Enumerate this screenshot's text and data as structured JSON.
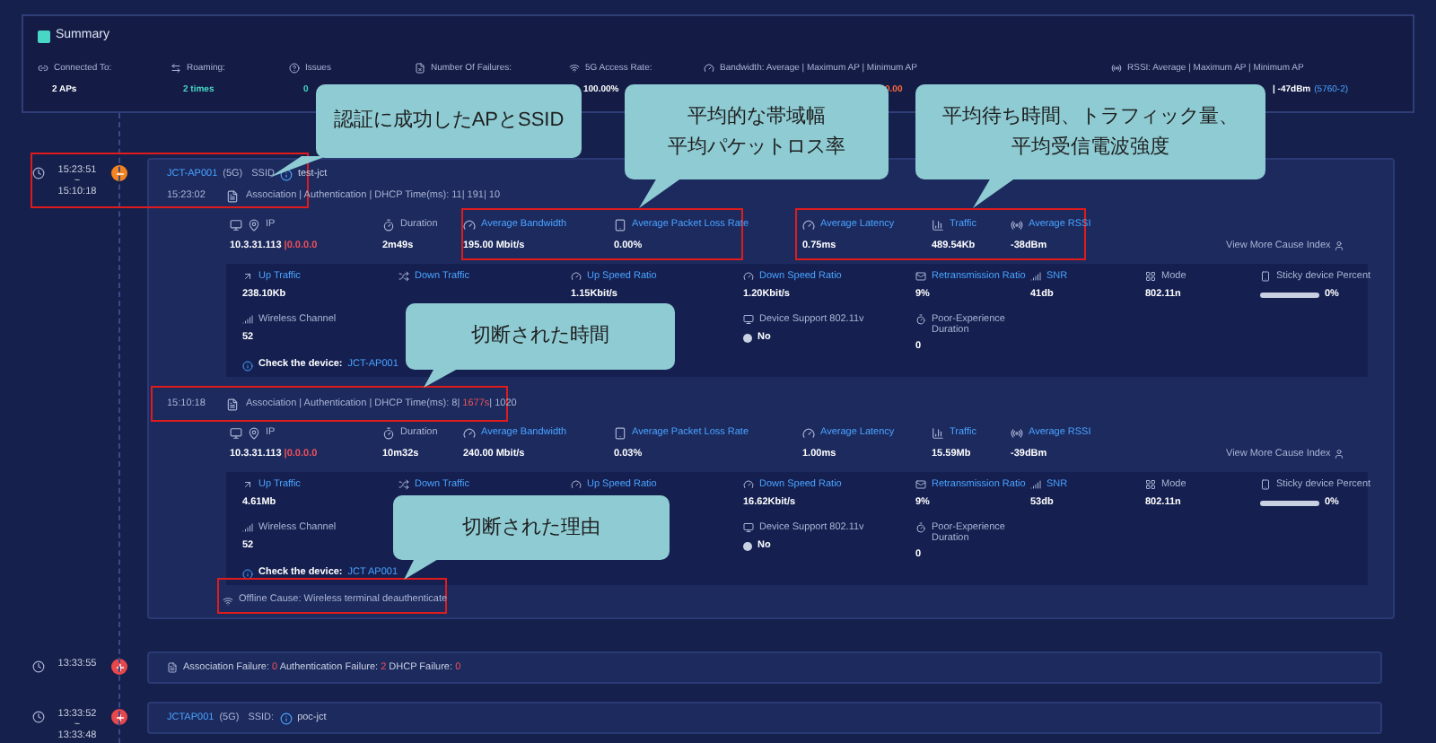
{
  "summary": {
    "title": "Summary",
    "items": [
      {
        "kind": "link",
        "label": "Connected To:",
        "value": "2 APs"
      },
      {
        "kind": "roam",
        "label": "Roaming:",
        "value": "2 times"
      },
      {
        "kind": "help",
        "label": "Issues",
        "value": "0"
      },
      {
        "kind": "fail",
        "label": "Number Of Failures:"
      },
      {
        "kind": "wifi",
        "label": "5G Access Rate:",
        "value": "100.00%"
      },
      {
        "kind": "gauge",
        "label": "Bandwidth: Average | Maximum AP | Minimum AP",
        "value_alert": "0.00"
      },
      {
        "kind": "signal",
        "label": "RSSI: Average | Maximum AP | Minimum AP",
        "value": "| -47dBm",
        "value_link": "(5760-2)"
      }
    ]
  },
  "timeline": [
    {
      "kind": "session",
      "expanded": true,
      "color": "#f5841f",
      "time_start": "15:23:51",
      "time_separator": "~",
      "time_end": "15:10:18",
      "ap": "JCT-AP001",
      "band": "(5G)",
      "ssid_label": "SSID",
      "ssid": "test-jct",
      "connections": [
        {
          "time": "15:23:02",
          "parts": [
            {
              "text": "Association | Authentication | DHCP Time(ms): 11| 191| 10",
              "alert": false
            }
          ],
          "metrics": [
            {
              "kind": "ip",
              "label": "IP",
              "value": "10.3.31.113",
              "value_alert": "|0.0.0.0",
              "link": false
            },
            {
              "kind": "time",
              "label": "Duration",
              "value": "2m49s",
              "link": false
            },
            {
              "kind": "gauge",
              "label": "Average Bandwidth",
              "value": "195.00 Mbit/s",
              "link": true
            },
            {
              "kind": "loss",
              "label": "Average Packet Loss Rate",
              "value": "0.00%",
              "link": true
            },
            {
              "kind": "gauge",
              "label": "Average Latency",
              "value": "0.75ms",
              "link": true
            },
            {
              "kind": "chart",
              "label": "Traffic",
              "value": "489.54Kb",
              "link": true
            },
            {
              "kind": "signal",
              "label": "Average RSSI",
              "value": "-38dBm",
              "link": true
            }
          ],
          "more": "View More Cause Index",
          "detail_rows": [
            [
              {
                "kind": "up",
                "label": "Up Traffic",
                "value": "238.10Kb",
                "link": true
              },
              {
                "kind": "cross",
                "label": "Down Traffic",
                "link": true
              },
              {
                "kind": "speed",
                "label": "Up Speed Ratio",
                "value": "1.15Kbit/s",
                "link": true
              },
              {
                "kind": "speed",
                "label": "Down Speed Ratio",
                "value": "1.20Kbit/s",
                "link": true
              },
              {
                "kind": "mail",
                "label": "Retransmission Ratio",
                "value": "9%",
                "link": true
              },
              {
                "kind": "snr",
                "label": "SNR",
                "value": "41db",
                "link": true
              },
              {
                "kind": "grid",
                "label": "Mode",
                "value": "802.11n",
                "link": false
              },
              {
                "kind": "bar",
                "label": "Sticky device Percent",
                "value": "0%",
                "level": 0,
                "link": false
              }
            ],
            [
              {
                "kind": "channel",
                "label": "Wireless Channel",
                "value": "52",
                "link": false
              },
              {
                "kind": "blank"
              },
              {
                "kind": "blank"
              },
              {
                "kind": "monitor",
                "label": "Device Support 802.11v",
                "value": "No",
                "link": false
              },
              {
                "kind": "time",
                "label": "Poor-Experience Duration",
                "value": "0",
                "link": false
              }
            ]
          ],
          "check_label": "Check the device:",
          "check_device": "JCT-AP001"
        },
        {
          "time": "15:10:18",
          "parts": [
            {
              "text": "Association | Authentication | DHCP Time(ms): 8| ",
              "alert": false
            },
            {
              "text": "1677s",
              "alert": true
            },
            {
              "text": "| 1020",
              "alert": false
            }
          ],
          "metrics": [
            {
              "kind": "ip",
              "label": "IP",
              "value": "10.3.31.113",
              "value_alert": "|0.0.0.0",
              "link": false
            },
            {
              "kind": "time",
              "label": "Duration",
              "value": "10m32s",
              "link": false
            },
            {
              "kind": "gauge",
              "label": "Average Bandwidth",
              "value": "240.00 Mbit/s",
              "link": true
            },
            {
              "kind": "loss",
              "label": "Average Packet Loss Rate",
              "value": "0.03%",
              "link": true
            },
            {
              "kind": "gauge",
              "label": "Average Latency",
              "value": "1.00ms",
              "link": true
            },
            {
              "kind": "chart",
              "label": "Traffic",
              "value": "15.59Mb",
              "link": true
            },
            {
              "kind": "signal",
              "label": "Average RSSI",
              "value": "-39dBm",
              "link": true
            }
          ],
          "more": "View More Cause Index",
          "detail_rows": [
            [
              {
                "kind": "up",
                "label": "Up Traffic",
                "value": "4.61Mb",
                "link": true
              },
              {
                "kind": "cross",
                "label": "Down Traffic",
                "link": true
              },
              {
                "kind": "speed",
                "label": "Up Speed Ratio",
                "link": true
              },
              {
                "kind": "speed",
                "label": "Down Speed Ratio",
                "value": "16.62Kbit/s",
                "link": true
              },
              {
                "kind": "mail",
                "label": "Retransmission Ratio",
                "value": "9%",
                "link": true
              },
              {
                "kind": "snr",
                "label": "SNR",
                "value": "53db",
                "link": true
              },
              {
                "kind": "grid",
                "label": "Mode",
                "value": "802.11n",
                "link": false
              },
              {
                "kind": "bar",
                "label": "Sticky device Percent",
                "value": "0%",
                "level": 0,
                "link": false
              }
            ],
            [
              {
                "kind": "channel",
                "label": "Wireless Channel",
                "value": "52",
                "link": false
              },
              {
                "kind": "blank"
              },
              {
                "kind": "blank"
              },
              {
                "kind": "monitor",
                "label": "Device Support 802.11v",
                "value": "No",
                "link": false
              },
              {
                "kind": "time",
                "label": "Poor-Experience Duration",
                "value": "0",
                "link": false
              }
            ]
          ],
          "check_label": "Check the device:",
          "check_device": "JCT AP001",
          "offline_cause": "Offline Cause: Wireless terminal deauthenticate"
        }
      ]
    },
    {
      "kind": "failure",
      "expanded": false,
      "color": "#e8474c",
      "time_start": "13:33:55",
      "parts": [
        {
          "text": "Association Failure: ",
          "alert": false
        },
        {
          "text": "0",
          "alert": true
        },
        {
          "text": " Authentication Failure: ",
          "alert": false
        },
        {
          "text": "2",
          "alert": true
        },
        {
          "text": " DHCP Failure: ",
          "alert": false
        },
        {
          "text": "0",
          "alert": true
        }
      ]
    },
    {
      "kind": "session",
      "expanded": false,
      "color": "#e8474c",
      "time_start": "13:33:52",
      "time_separator": "~",
      "time_end": "13:33:48",
      "ap": "JCTAP001",
      "band": "(5G)",
      "ssid_label": "SSID:",
      "ssid": "poc-jct"
    }
  ],
  "callouts": [
    {
      "lines": [
        "認証に成功したAPとSSID"
      ]
    },
    {
      "lines": [
        "平均的な帯域幅",
        "平均パケットロス率"
      ]
    },
    {
      "lines": [
        "平均待ち時間、トラフィック量、",
        "平均受信電波強度"
      ]
    },
    {
      "lines": [
        "切断された時間"
      ]
    },
    {
      "lines": [
        "切断された理由"
      ]
    }
  ]
}
